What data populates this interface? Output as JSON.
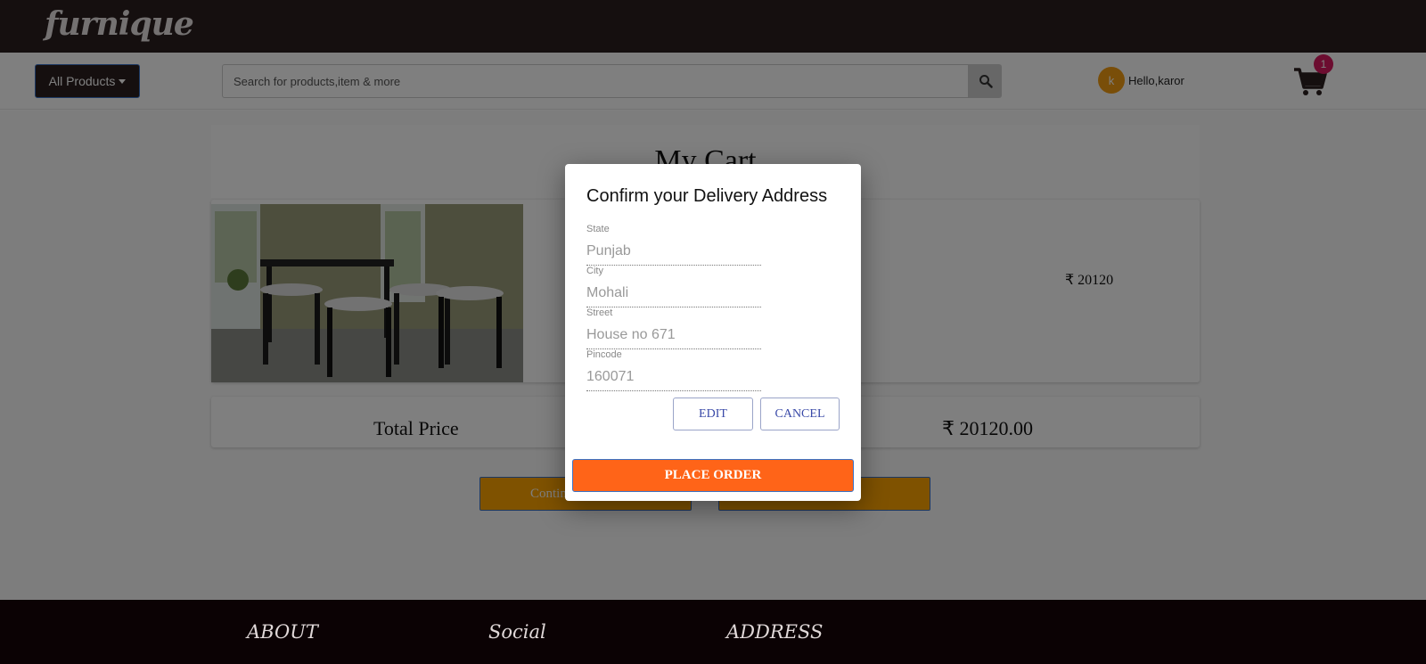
{
  "brand": {
    "logo": "furnique"
  },
  "navbar": {
    "all_products_label": "All Products",
    "search_placeholder": "Search for products,item & more",
    "user_initial": "k",
    "user_greeting": "Hello,karor",
    "cart_count": "1"
  },
  "cart": {
    "title": "My Cart",
    "item": {
      "price": "₹ 20120"
    },
    "total_label": "Total Price",
    "total_value": "₹ 20120.00",
    "continue_label": "Contin"
  },
  "footer": {
    "about": "ABOUT",
    "social": "Social",
    "address": "ADDRESS"
  },
  "modal": {
    "title": "Confirm your Delivery Address",
    "fields": [
      {
        "label": "State",
        "value": "Punjab"
      },
      {
        "label": "City",
        "value": "Mohali"
      },
      {
        "label": "Street",
        "value": "House no 671"
      },
      {
        "label": "Pincode",
        "value": "160071"
      }
    ],
    "edit_label": "EDIT",
    "cancel_label": "CANCEL",
    "place_order_label": "PLACE ORDER"
  },
  "colors": {
    "header_bg": "#2a1f1f",
    "accent_orange": "#ffa500",
    "place_order": "#ff6418",
    "badge": "#d81b60",
    "avatar": "#f39c12"
  }
}
